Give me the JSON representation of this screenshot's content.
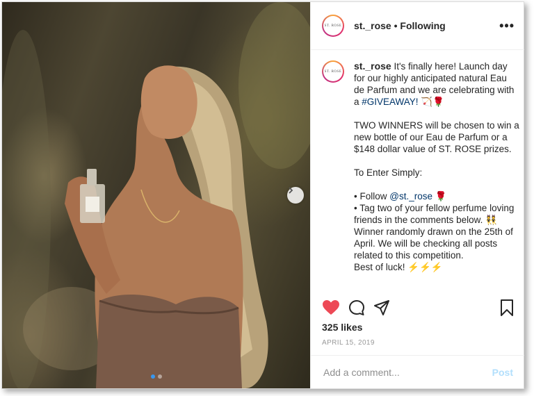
{
  "post": {
    "username": "st._rose",
    "follow_separator": " • ",
    "follow_status": "Following",
    "more_label": "•••",
    "avatar_text": "ST. ROSE",
    "caption": {
      "p1_after_user": " It's finally here! Launch day for our highly anticipated natural Eau de Parfum and we are celebrating with a ",
      "hashtag": "#GIVEAWAY!",
      "p1_emoji": " 🏹🌹",
      "p2": "TWO WINNERS will be chosen to win a new bottle of our Eau de Parfum or a $148 dollar value of ST. ROSE prizes.",
      "p3": "To Enter Simply:",
      "bullet1_prefix": "• Follow ",
      "bullet1_mention": "@st._rose",
      "bullet1_emoji": " 🌹",
      "bullet2": "• Tag two of your fellow perfume loving friends in the comments below. 👯",
      "winner": "Winner randomly drawn on the 25th of April. We will be checking all posts related to this competition.",
      "closing": "Best of luck! ⚡⚡⚡"
    },
    "likes": "325 likes",
    "date": "APRIL 15, 2019",
    "comment_placeholder": "Add a comment...",
    "post_button": "Post",
    "carousel": {
      "slides": 2,
      "active": 1
    }
  },
  "icons": {
    "like": "heart-filled-icon",
    "comment": "comment-icon",
    "share": "share-icon",
    "save": "bookmark-icon",
    "next": "chevron-right-icon",
    "more": "more-icon"
  },
  "colors": {
    "like_red": "#ed4956",
    "link_blue": "#003569",
    "post_disabled": "#b2dffc",
    "dot_active": "#3897f0"
  }
}
